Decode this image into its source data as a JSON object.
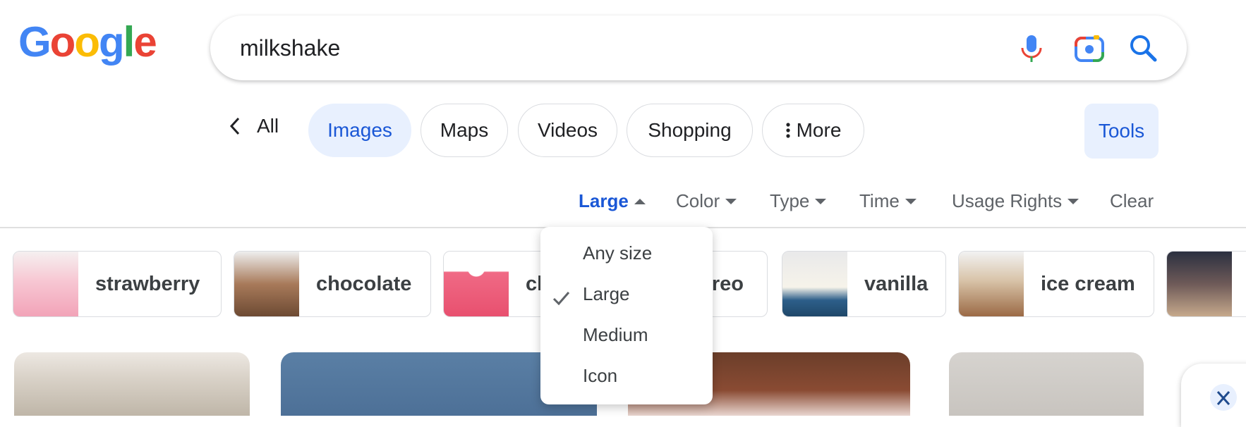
{
  "search": {
    "query": "milkshake"
  },
  "tabs": [
    {
      "label": "All"
    },
    {
      "label": "Images"
    },
    {
      "label": "Maps"
    },
    {
      "label": "Videos"
    },
    {
      "label": "Shopping"
    },
    {
      "label": "More"
    }
  ],
  "tools_label": "Tools",
  "filters": [
    {
      "label": "Large"
    },
    {
      "label": "Color"
    },
    {
      "label": "Type"
    },
    {
      "label": "Time"
    },
    {
      "label": "Usage Rights"
    }
  ],
  "clear_label": "Clear",
  "chips": [
    {
      "label": "strawberry"
    },
    {
      "label": "chocolate"
    },
    {
      "label": "cl"
    },
    {
      "label": "oreo"
    },
    {
      "label": "vanilla"
    },
    {
      "label": "ice cream"
    }
  ],
  "size_menu": {
    "items": [
      "Any size",
      "Large",
      "Medium",
      "Icon"
    ],
    "selected": "Large"
  },
  "colors": {
    "accent": "#1a57d6",
    "tab_selected_bg": "#e8f0fe"
  }
}
